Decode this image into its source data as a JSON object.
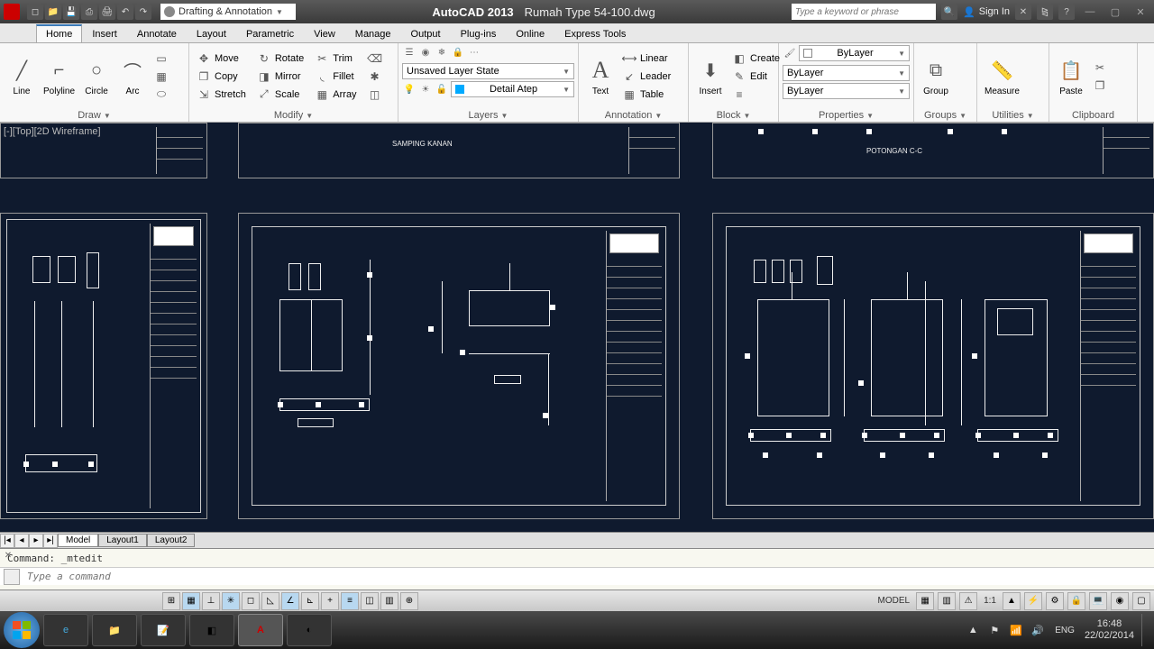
{
  "titlebar": {
    "app_name": "AutoCAD 2013",
    "file_name": "Rumah Type 54-100.dwg",
    "workspace": "Drafting & Annotation",
    "search_placeholder": "Type a keyword or phrase",
    "signin": "Sign In"
  },
  "tabs": [
    "Home",
    "Insert",
    "Annotate",
    "Layout",
    "Parametric",
    "View",
    "Manage",
    "Output",
    "Plug-ins",
    "Online",
    "Express Tools"
  ],
  "active_tab": "Home",
  "panels": {
    "draw": {
      "title": "Draw",
      "line": "Line",
      "polyline": "Polyline",
      "circle": "Circle",
      "arc": "Arc"
    },
    "modify": {
      "title": "Modify",
      "move": "Move",
      "rotate": "Rotate",
      "trim": "Trim",
      "copy": "Copy",
      "mirror": "Mirror",
      "fillet": "Fillet",
      "stretch": "Stretch",
      "scale": "Scale",
      "array": "Array"
    },
    "layers": {
      "title": "Layers",
      "state": "Unsaved Layer State",
      "current": "Detail Atep"
    },
    "annotation": {
      "title": "Annotation",
      "text": "Text",
      "linear": "Linear",
      "leader": "Leader",
      "table": "Table"
    },
    "block": {
      "title": "Block",
      "insert": "Insert",
      "create": "Create",
      "edit": "Edit"
    },
    "properties": {
      "title": "Properties",
      "color": "ByLayer",
      "line": "ByLayer",
      "lw": "ByLayer"
    },
    "groups": {
      "title": "Groups",
      "group": "Group"
    },
    "utilities": {
      "title": "Utilities",
      "measure": "Measure"
    },
    "clipboard": {
      "title": "Clipboard",
      "paste": "Paste"
    }
  },
  "viewport_control": "[-][Top][2D Wireframe]",
  "drawing_labels": {
    "samping": "SAMPING KANAN",
    "potongan": "POTONGAN C-C"
  },
  "footer_tabs": {
    "model": "Model",
    "layout1": "Layout1",
    "layout2": "Layout2"
  },
  "command": {
    "history": "Command: _mtedit",
    "placeholder": "Type a command"
  },
  "status": {
    "model": "MODEL",
    "scale": "1:1",
    "lang": "ENG"
  },
  "tray": {
    "time": "16:48",
    "date": "22/02/2014"
  }
}
